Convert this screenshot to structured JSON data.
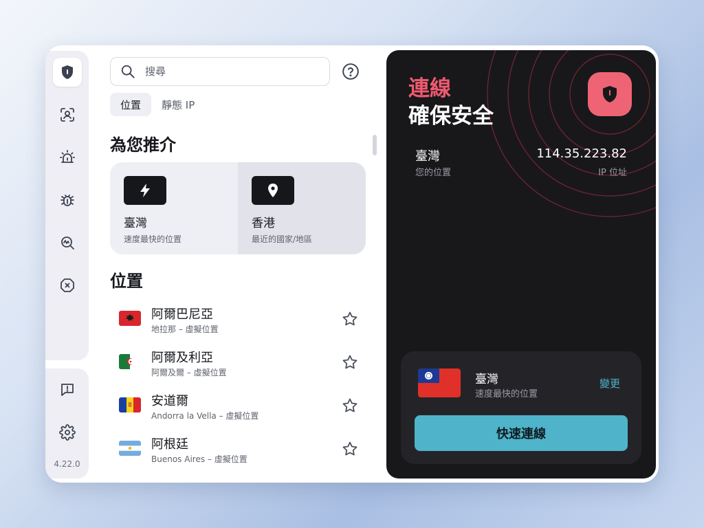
{
  "app": {
    "version": "4.22.0"
  },
  "search": {
    "placeholder": "搜尋"
  },
  "tabs": [
    {
      "label": "位置"
    },
    {
      "label": "靜態 IP"
    }
  ],
  "recommended": {
    "title": "為您推介",
    "items": [
      {
        "name": "臺灣",
        "sub": "速度最快的位置",
        "icon": "lightning-icon"
      },
      {
        "name": "香港",
        "sub": "最近的國家/地區",
        "icon": "location-pin-icon"
      }
    ]
  },
  "locations": {
    "title": "位置",
    "items": [
      {
        "name": "阿爾巴尼亞",
        "sub": "地拉那 – 虛擬位置",
        "flag": "albania"
      },
      {
        "name": "阿爾及利亞",
        "sub": "阿爾及爾 – 虛擬位置",
        "flag": "algeria"
      },
      {
        "name": "安道爾",
        "sub": "Andorra la Vella – 虛擬位置",
        "flag": "andorra"
      },
      {
        "name": "阿根廷",
        "sub": "Buenos Aires – 虛擬位置",
        "flag": "argentina"
      }
    ]
  },
  "status": {
    "line1": "連線",
    "line2": "確保安全",
    "location": "臺灣",
    "location_label": "您的位置",
    "ip": "114.35.223.82",
    "ip_label": "IP 位址"
  },
  "connect": {
    "name": "臺灣",
    "sub": "速度最快的位置",
    "change_label": "變更",
    "button_label": "快速連線"
  },
  "colors": {
    "accent_red": "#ef5a6f",
    "accent_teal": "#4fb3ca",
    "panel_bg": "#18181b"
  }
}
